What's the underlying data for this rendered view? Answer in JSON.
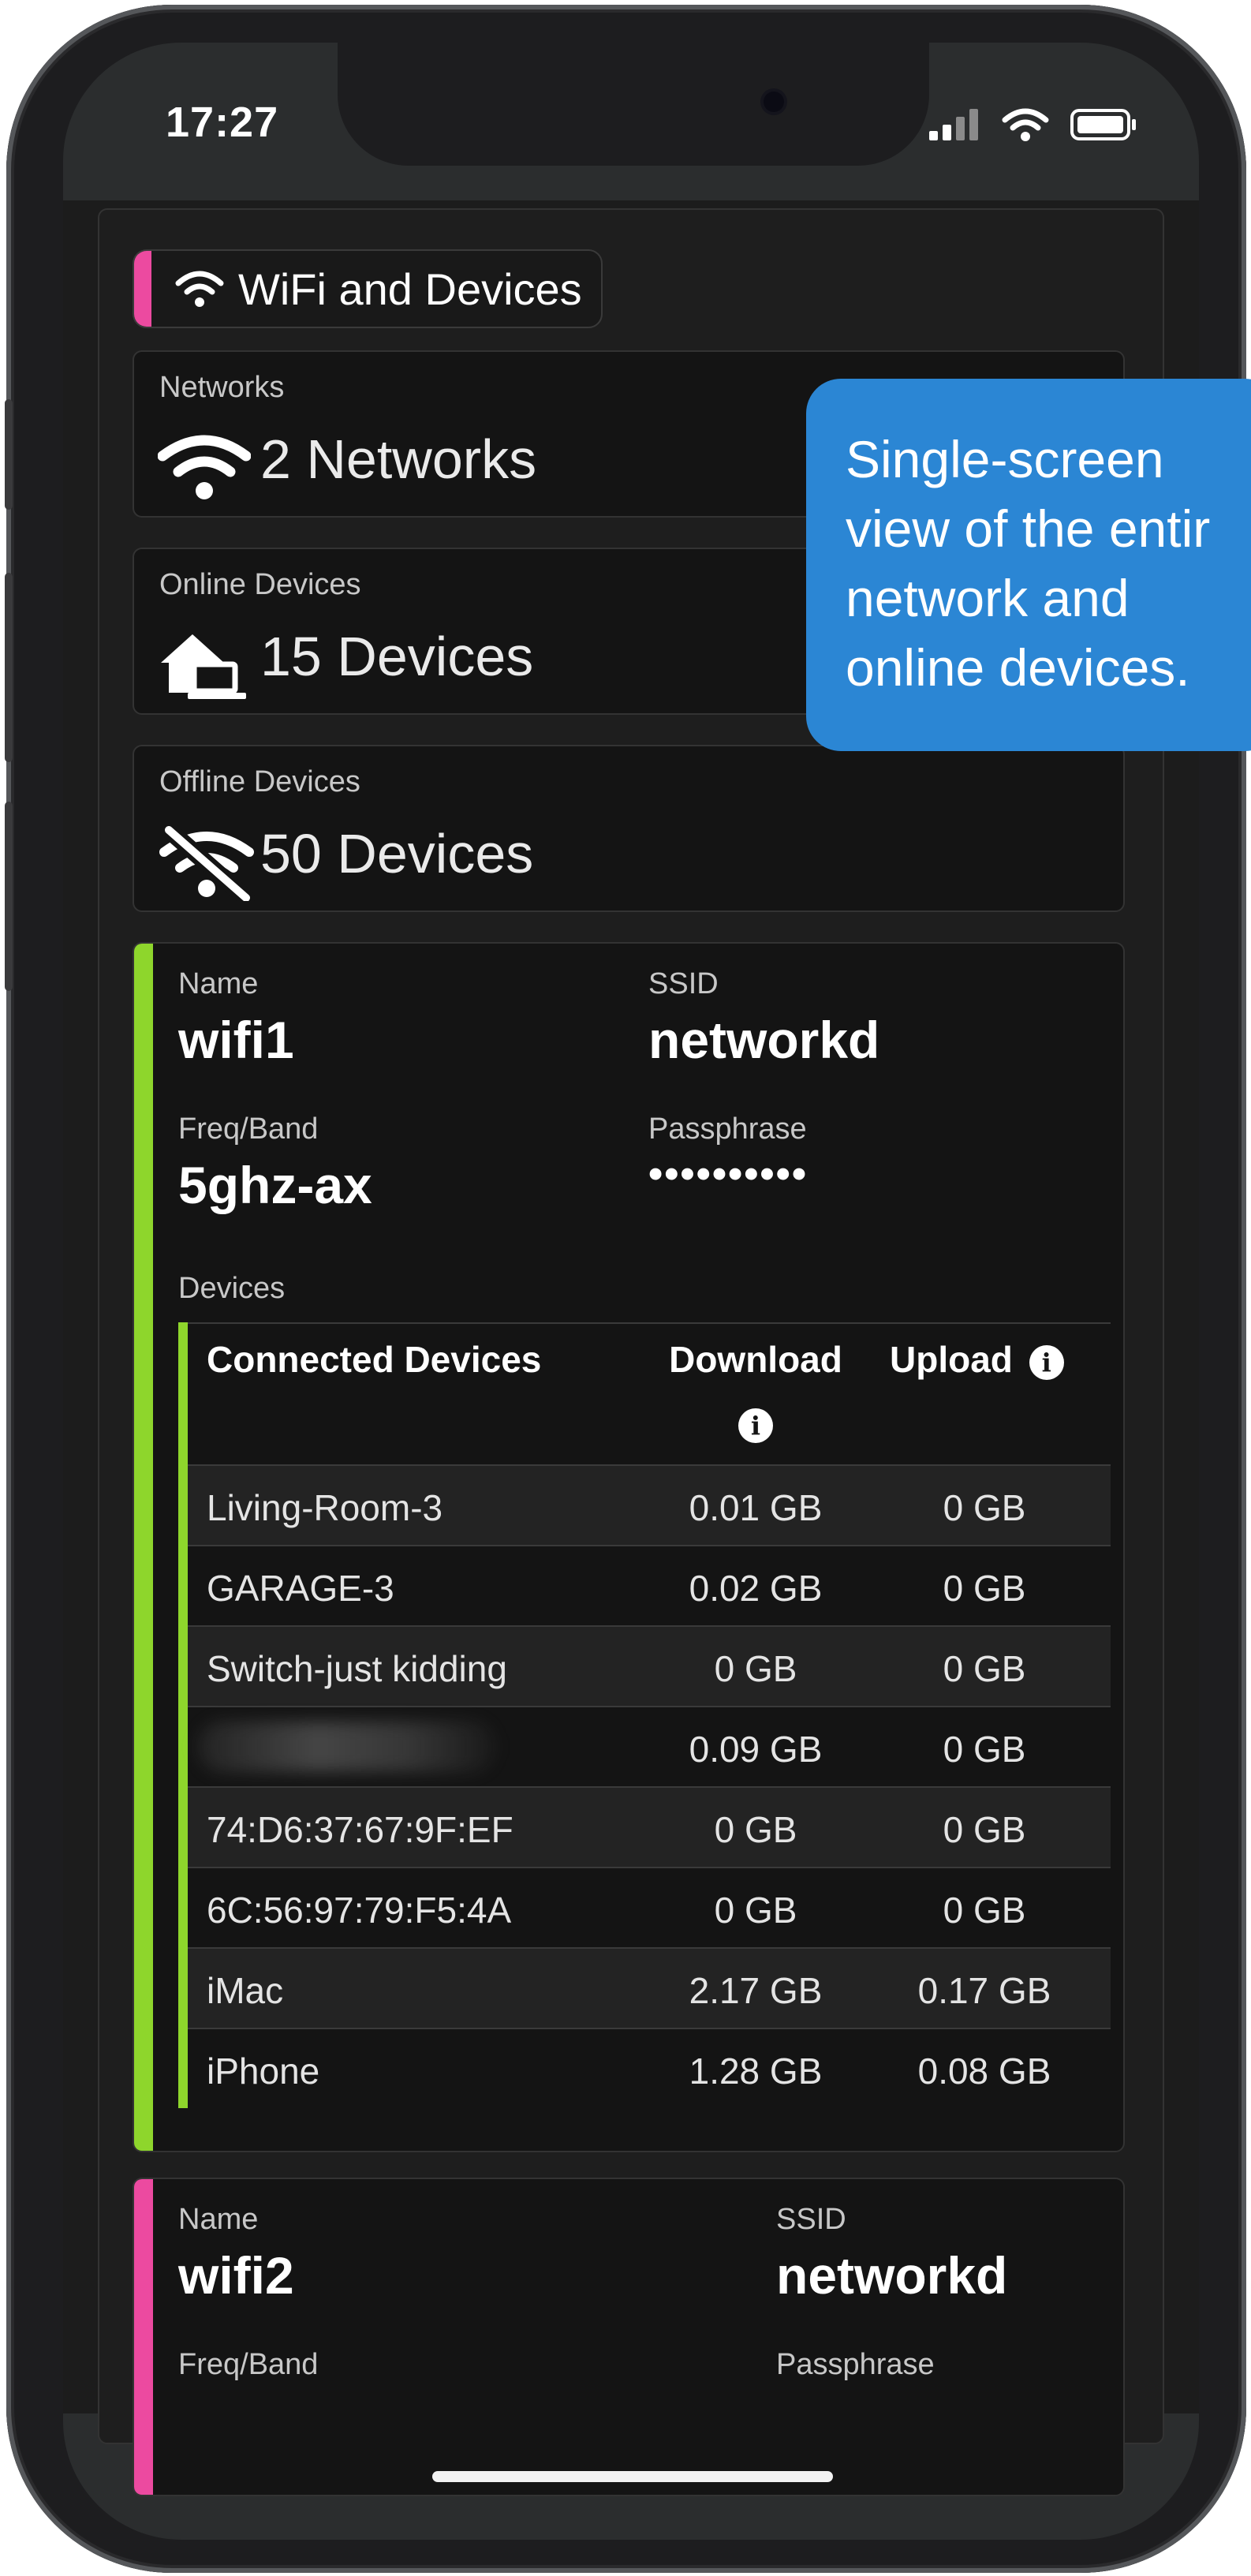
{
  "status_bar": {
    "time": "17:27"
  },
  "section": {
    "title": "WiFi and Devices"
  },
  "stats": [
    {
      "caption": "Networks",
      "value": "2 Networks",
      "icon": "wifi-icon"
    },
    {
      "caption": "Online Devices",
      "value": "15 Devices",
      "icon": "home-devices-icon"
    },
    {
      "caption": "Offline Devices",
      "value": "50 Devices",
      "icon": "wifi-off-icon"
    }
  ],
  "network1": {
    "accent": "#8ed62c",
    "name_label": "Name",
    "name": "wifi1",
    "ssid_label": "SSID",
    "ssid": "networkd",
    "freq_label": "Freq/Band",
    "freq": "5ghz-ax",
    "pass_label": "Passphrase",
    "pass": "••••••••••",
    "devices_label": "Devices",
    "table": {
      "headers": {
        "device": "Connected Devices",
        "download": "Download",
        "upload": "Upload"
      },
      "rows": [
        {
          "device": "Living-Room-3",
          "download": "0.01 GB",
          "upload": "0 GB"
        },
        {
          "device": "GARAGE-3",
          "download": "0.02 GB",
          "upload": "0 GB"
        },
        {
          "device": "Switch-just kidding",
          "download": "0 GB",
          "upload": "0 GB"
        },
        {
          "device": "",
          "download": "0.09 GB",
          "upload": "0 GB"
        },
        {
          "device": "74:D6:37:67:9F:EF",
          "download": "0 GB",
          "upload": "0 GB"
        },
        {
          "device": "6C:56:97:79:F5:4A",
          "download": "0 GB",
          "upload": "0 GB"
        },
        {
          "device": "iMac",
          "download": "2.17 GB",
          "upload": "0.17 GB"
        },
        {
          "device": "iPhone",
          "download": "1.28 GB",
          "upload": "0.08 GB"
        }
      ]
    }
  },
  "network2": {
    "accent": "#ec4aa0",
    "name_label": "Name",
    "name": "wifi2",
    "ssid_label": "SSID",
    "ssid": "networkd",
    "freq_label": "Freq/Band",
    "pass_label": "Passphrase"
  },
  "callout": {
    "lines": [
      "Single-screen",
      "view of the entir",
      "network and",
      "online devices."
    ]
  },
  "colors": {
    "callout_bg": "#2b86d4",
    "section_accent": "#ec4aa0"
  }
}
